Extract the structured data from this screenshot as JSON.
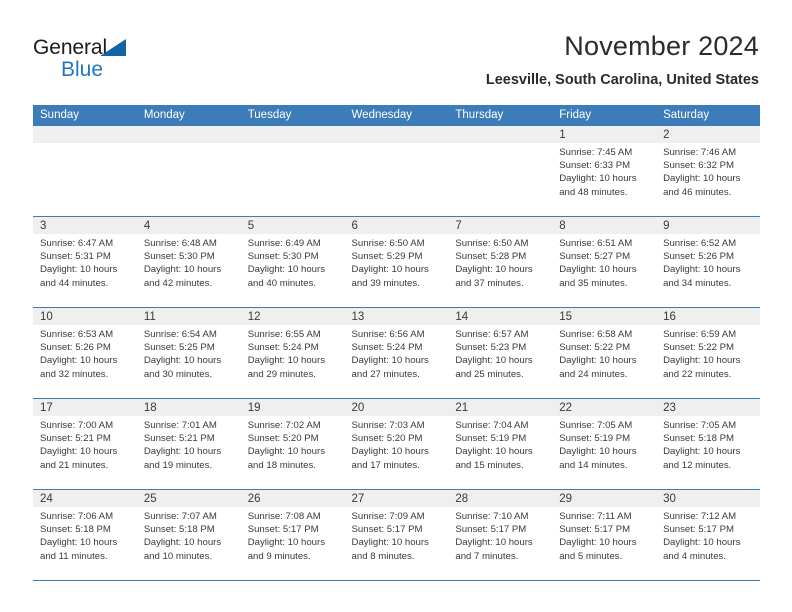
{
  "brand": {
    "name_part1": "General",
    "name_part2": "Blue",
    "accent_color": "#1f77c4",
    "triangle_color": "#1464a5"
  },
  "header": {
    "title": "November 2024",
    "location": "Leesville, South Carolina, United States"
  },
  "calendar": {
    "header_bg": "#3b7cb9",
    "daynum_bg": "#efefef",
    "weekday_headers": [
      "Sunday",
      "Monday",
      "Tuesday",
      "Wednesday",
      "Thursday",
      "Friday",
      "Saturday"
    ],
    "weeks": [
      [
        {
          "day": "",
          "sunrise": "",
          "sunset": "",
          "daylight": "",
          "empty": true
        },
        {
          "day": "",
          "sunrise": "",
          "sunset": "",
          "daylight": "",
          "empty": true
        },
        {
          "day": "",
          "sunrise": "",
          "sunset": "",
          "daylight": "",
          "empty": true
        },
        {
          "day": "",
          "sunrise": "",
          "sunset": "",
          "daylight": "",
          "empty": true
        },
        {
          "day": "",
          "sunrise": "",
          "sunset": "",
          "daylight": "",
          "empty": true
        },
        {
          "day": "1",
          "sunrise": "Sunrise: 7:45 AM",
          "sunset": "Sunset: 6:33 PM",
          "daylight": "Daylight: 10 hours and 48 minutes."
        },
        {
          "day": "2",
          "sunrise": "Sunrise: 7:46 AM",
          "sunset": "Sunset: 6:32 PM",
          "daylight": "Daylight: 10 hours and 46 minutes."
        }
      ],
      [
        {
          "day": "3",
          "sunrise": "Sunrise: 6:47 AM",
          "sunset": "Sunset: 5:31 PM",
          "daylight": "Daylight: 10 hours and 44 minutes."
        },
        {
          "day": "4",
          "sunrise": "Sunrise: 6:48 AM",
          "sunset": "Sunset: 5:30 PM",
          "daylight": "Daylight: 10 hours and 42 minutes."
        },
        {
          "day": "5",
          "sunrise": "Sunrise: 6:49 AM",
          "sunset": "Sunset: 5:30 PM",
          "daylight": "Daylight: 10 hours and 40 minutes."
        },
        {
          "day": "6",
          "sunrise": "Sunrise: 6:50 AM",
          "sunset": "Sunset: 5:29 PM",
          "daylight": "Daylight: 10 hours and 39 minutes."
        },
        {
          "day": "7",
          "sunrise": "Sunrise: 6:50 AM",
          "sunset": "Sunset: 5:28 PM",
          "daylight": "Daylight: 10 hours and 37 minutes."
        },
        {
          "day": "8",
          "sunrise": "Sunrise: 6:51 AM",
          "sunset": "Sunset: 5:27 PM",
          "daylight": "Daylight: 10 hours and 35 minutes."
        },
        {
          "day": "9",
          "sunrise": "Sunrise: 6:52 AM",
          "sunset": "Sunset: 5:26 PM",
          "daylight": "Daylight: 10 hours and 34 minutes."
        }
      ],
      [
        {
          "day": "10",
          "sunrise": "Sunrise: 6:53 AM",
          "sunset": "Sunset: 5:26 PM",
          "daylight": "Daylight: 10 hours and 32 minutes."
        },
        {
          "day": "11",
          "sunrise": "Sunrise: 6:54 AM",
          "sunset": "Sunset: 5:25 PM",
          "daylight": "Daylight: 10 hours and 30 minutes."
        },
        {
          "day": "12",
          "sunrise": "Sunrise: 6:55 AM",
          "sunset": "Sunset: 5:24 PM",
          "daylight": "Daylight: 10 hours and 29 minutes."
        },
        {
          "day": "13",
          "sunrise": "Sunrise: 6:56 AM",
          "sunset": "Sunset: 5:24 PM",
          "daylight": "Daylight: 10 hours and 27 minutes."
        },
        {
          "day": "14",
          "sunrise": "Sunrise: 6:57 AM",
          "sunset": "Sunset: 5:23 PM",
          "daylight": "Daylight: 10 hours and 25 minutes."
        },
        {
          "day": "15",
          "sunrise": "Sunrise: 6:58 AM",
          "sunset": "Sunset: 5:22 PM",
          "daylight": "Daylight: 10 hours and 24 minutes."
        },
        {
          "day": "16",
          "sunrise": "Sunrise: 6:59 AM",
          "sunset": "Sunset: 5:22 PM",
          "daylight": "Daylight: 10 hours and 22 minutes."
        }
      ],
      [
        {
          "day": "17",
          "sunrise": "Sunrise: 7:00 AM",
          "sunset": "Sunset: 5:21 PM",
          "daylight": "Daylight: 10 hours and 21 minutes."
        },
        {
          "day": "18",
          "sunrise": "Sunrise: 7:01 AM",
          "sunset": "Sunset: 5:21 PM",
          "daylight": "Daylight: 10 hours and 19 minutes."
        },
        {
          "day": "19",
          "sunrise": "Sunrise: 7:02 AM",
          "sunset": "Sunset: 5:20 PM",
          "daylight": "Daylight: 10 hours and 18 minutes."
        },
        {
          "day": "20",
          "sunrise": "Sunrise: 7:03 AM",
          "sunset": "Sunset: 5:20 PM",
          "daylight": "Daylight: 10 hours and 17 minutes."
        },
        {
          "day": "21",
          "sunrise": "Sunrise: 7:04 AM",
          "sunset": "Sunset: 5:19 PM",
          "daylight": "Daylight: 10 hours and 15 minutes."
        },
        {
          "day": "22",
          "sunrise": "Sunrise: 7:05 AM",
          "sunset": "Sunset: 5:19 PM",
          "daylight": "Daylight: 10 hours and 14 minutes."
        },
        {
          "day": "23",
          "sunrise": "Sunrise: 7:05 AM",
          "sunset": "Sunset: 5:18 PM",
          "daylight": "Daylight: 10 hours and 12 minutes."
        }
      ],
      [
        {
          "day": "24",
          "sunrise": "Sunrise: 7:06 AM",
          "sunset": "Sunset: 5:18 PM",
          "daylight": "Daylight: 10 hours and 11 minutes."
        },
        {
          "day": "25",
          "sunrise": "Sunrise: 7:07 AM",
          "sunset": "Sunset: 5:18 PM",
          "daylight": "Daylight: 10 hours and 10 minutes."
        },
        {
          "day": "26",
          "sunrise": "Sunrise: 7:08 AM",
          "sunset": "Sunset: 5:17 PM",
          "daylight": "Daylight: 10 hours and 9 minutes."
        },
        {
          "day": "27",
          "sunrise": "Sunrise: 7:09 AM",
          "sunset": "Sunset: 5:17 PM",
          "daylight": "Daylight: 10 hours and 8 minutes."
        },
        {
          "day": "28",
          "sunrise": "Sunrise: 7:10 AM",
          "sunset": "Sunset: 5:17 PM",
          "daylight": "Daylight: 10 hours and 7 minutes."
        },
        {
          "day": "29",
          "sunrise": "Sunrise: 7:11 AM",
          "sunset": "Sunset: 5:17 PM",
          "daylight": "Daylight: 10 hours and 5 minutes."
        },
        {
          "day": "30",
          "sunrise": "Sunrise: 7:12 AM",
          "sunset": "Sunset: 5:17 PM",
          "daylight": "Daylight: 10 hours and 4 minutes."
        }
      ]
    ]
  }
}
